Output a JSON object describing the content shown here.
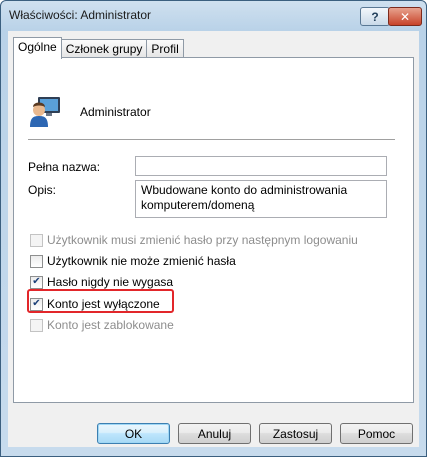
{
  "window": {
    "title": "Właściwości: Administrator"
  },
  "titlebar": {
    "help_label": "?",
    "close_label": "✕"
  },
  "tabs": [
    {
      "label": "Ogólne",
      "active": true
    },
    {
      "label": "Członek grupy",
      "active": false
    },
    {
      "label": "Profil",
      "active": false
    }
  ],
  "user": {
    "name": "Administrator",
    "icon": "user-icon"
  },
  "fields": {
    "full_name": {
      "label": "Pełna nazwa:",
      "value": ""
    },
    "description": {
      "label": "Opis:",
      "value": "Wbudowane konto do administrowania\nkomputerem/domeną"
    }
  },
  "options": [
    {
      "label": "Użytkownik musi zmienić hasło przy następnym logowaniu",
      "checked": false,
      "enabled": false
    },
    {
      "label": "Użytkownik nie może zmienić hasła",
      "checked": false,
      "enabled": true
    },
    {
      "label": "Hasło nigdy nie wygasa",
      "checked": true,
      "enabled": true
    },
    {
      "label": "Konto jest wyłączone",
      "checked": true,
      "enabled": true,
      "highlighted": true
    },
    {
      "label": "Konto jest zablokowane",
      "checked": false,
      "enabled": false
    }
  ],
  "buttons": {
    "ok": "OK",
    "cancel": "Anuluj",
    "apply": "Zastosuj",
    "help": "Pomoc"
  },
  "colors": {
    "highlight_border": "#e2262a",
    "check_mark": "#1c3f78"
  }
}
